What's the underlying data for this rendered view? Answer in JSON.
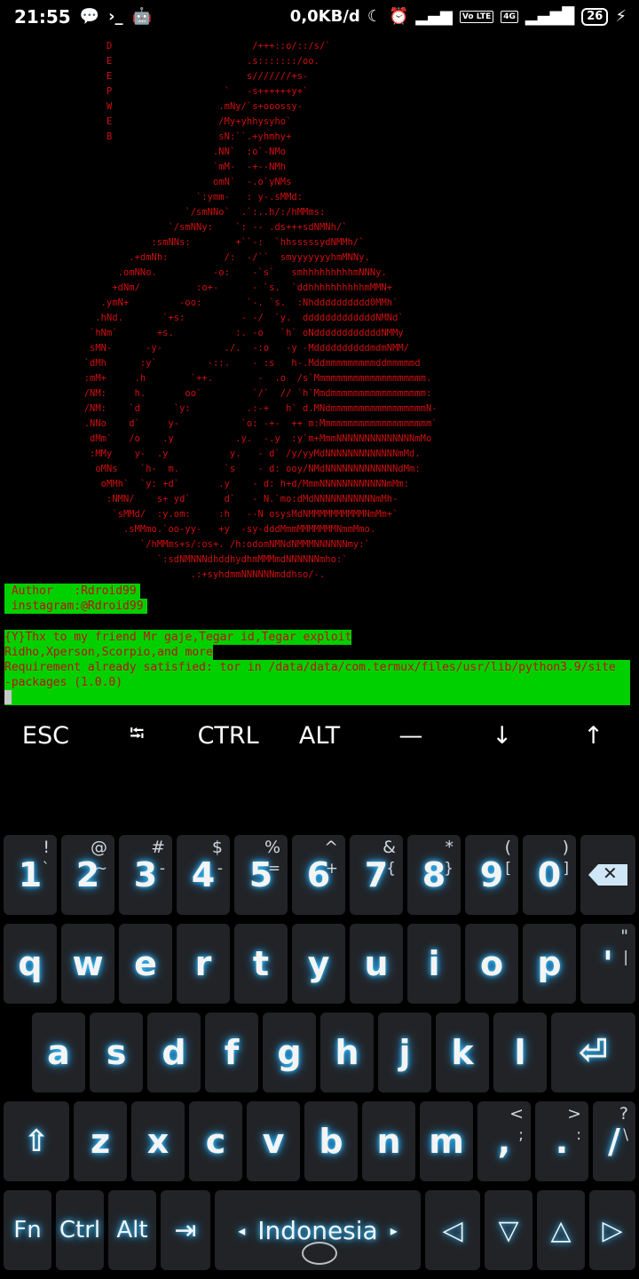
{
  "status_bar": {
    "time": "21:55",
    "left_icons": [
      "chat-icon",
      "terminal-prompt-icon",
      "android-icon"
    ],
    "prompt_glyph": "›_",
    "network_speed": "0,0KB/d",
    "network_badge_1": "Vo LTE",
    "network_badge_2": "4G",
    "battery": "26"
  },
  "terminal": {
    "ascii_art": "                   D                         /+++::o/::/s/`\n                   E                        .s:::::::/oo.\n                   E                        s///////+s-\n                   P                    `   -s++++++y+`\n                   W                   .mNy/`s+ooossy-\n                   E                   /My+yhhysyho`\n                   B                   sN:``.+yhmhy+\n                                      .NN`  :o`-NMo\n                                      `mM-  -+--NMh\n                                      omN`  -.o`yNMs\n                                   `:ymm-   : y-.sMMd:\n                                 `/smNNo`  .`:..h/:/hMMms:\n                              `/smNNy:    `: -- .ds+++sdNMNh/`\n                           :smNNs:        +``-:  `hhsssssydNMMh/`\n                       .+dmNh:          /:  -/``  smyyyyyyyhmMNNy.\n                     .omNNo.          -o:    -`s`   smhhhhhhhhhmNNNy.\n                    +dNm/          :o+-      - `s.  `ddhhhhhhhhhhmMMN+\n                  .ymN+         -oo:        `-. `s.  :Nhdddddddddd0MMh`\n                 .hNd.       `+s:          - -/  `y.  dddddddddddddNMNd`\n                `hNm`       +s.           :. -o   `h` oNddddddddddddNMMy\n                sMN-      -y-           ./.  -:o   -y -MddddddddddmdmNMM/\n               `dMh      :y`         -::.    - :s   h-.Mddmmmmmmmmmddmmmmmd\n               :mM+     .h        `++.        -  .o  /s`Mmmmmmmmmmmmmmmmmmmm.\n               /NM:     h.       oo`         `/`  // `h`Mmdmmmmmmmmmmmmmmmmm:\n               /NM:    `d      `y:          .:-+   h` d.MNdmmmmmmmmmmmmmmmmmN-\n               .NNo    d`     y-           `o: -+-  ++ m:Mmmmmmmmmmmmmmmmmmmm`\n                dMm`   /o    .y           .y.  -.y  :y`m+MmmNNNNNNNNNNNNNNmMo\n                :MMy    y-  .y           y.   - d` /y/yyMdNNNNNNNNNNNNNmMd.\n                 oMNs    `h-  m.        `s    - d: ooy/NMdNNNNNNNNNNNNNdMm:\n                  oMMh`  `y: +d`       .y    - d: h+d/MmmNNNNNNNNNNNNmMm:\n                   :NMN/    s+ yd`      d`   - N.`mo:dMdNNNNNNNNNNNmMh-\n                    `sMMd/  :y.om:     :h   --N osysMdNMMMMMMMMMMNmMm+`\n                      .sMMmo.`oo-yy-   +y  -sy-dddMmmMMMMMMMNmmMmo.\n                         `/hMMms+s/:os+. /h:odomNMNdNMMMNNNNNNmy:`\n                            `:sdNMNNNdhddhydhmMMMmdNNNNNNmho:`\n                                  .:+syhdmmNNNNNNmddhso/-.",
    "author_line": " Author   :Rdroid99",
    "instagram_line": " instagram:@Rdroid99",
    "thanks_line_1": "{Y}Thx to my friend Mr gaje,Tegar id,Tegar exploit",
    "thanks_line_2": "Ridho,Xperson,Scorpio,and more",
    "requirement_line_1": "Requirement already satisfied: tor in /data/data/com.termux/files/usr/lib/python3.9/site",
    "requirement_line_2": "-packages (1.0.0)"
  },
  "extra_keys": [
    "ESC",
    "⭾",
    "CTRL",
    "ALT",
    "—",
    "↓",
    "↑"
  ],
  "keyboard": {
    "row1": [
      {
        "main": "1",
        "sec": "!",
        "sec2": "`"
      },
      {
        "main": "2",
        "sec": "@",
        "sec2": "~"
      },
      {
        "main": "3",
        "sec": "#",
        "sec2": "-"
      },
      {
        "main": "4",
        "sec": "$",
        "sec2": "-"
      },
      {
        "main": "5",
        "sec": "%",
        "sec2": "="
      },
      {
        "main": "6",
        "sec": "^",
        "sec2": "+"
      },
      {
        "main": "7",
        "sec": "&",
        "sec2": "{"
      },
      {
        "main": "8",
        "sec": "*",
        "sec2": "}"
      },
      {
        "main": "9",
        "sec": "(",
        "sec2": "["
      },
      {
        "main": "0",
        "sec": ")",
        "sec2": "]"
      }
    ],
    "row2": [
      "q",
      "w",
      "e",
      "r",
      "t",
      "y",
      "u",
      "i",
      "o",
      "p"
    ],
    "row2_extra": {
      "main": "'",
      "sec": "\"",
      "sec2": "|"
    },
    "row3": [
      "a",
      "s",
      "d",
      "f",
      "g",
      "h",
      "j",
      "k",
      "l"
    ],
    "row4": [
      "z",
      "x",
      "c",
      "v",
      "b",
      "n",
      "m"
    ],
    "row4_comma": ",",
    "row4_period": {
      "main": ".",
      "sec": ">",
      "sec2": ":"
    },
    "row4_comma_sec": {
      "sec": "<",
      "sec2": ";"
    },
    "row4_slash": {
      "main": "/",
      "sec": "?",
      "sec2": "\\"
    },
    "row5": {
      "fn": "Fn",
      "ctrl": "Ctrl",
      "alt": "Alt",
      "language": "Indonesia",
      "lang_left": "◂",
      "lang_right": "▸"
    }
  },
  "colors": {
    "terminal_text": "#d01010",
    "highlight": "#00d000",
    "key_bg": "#222326",
    "key_glow": "#1ea0ff"
  }
}
